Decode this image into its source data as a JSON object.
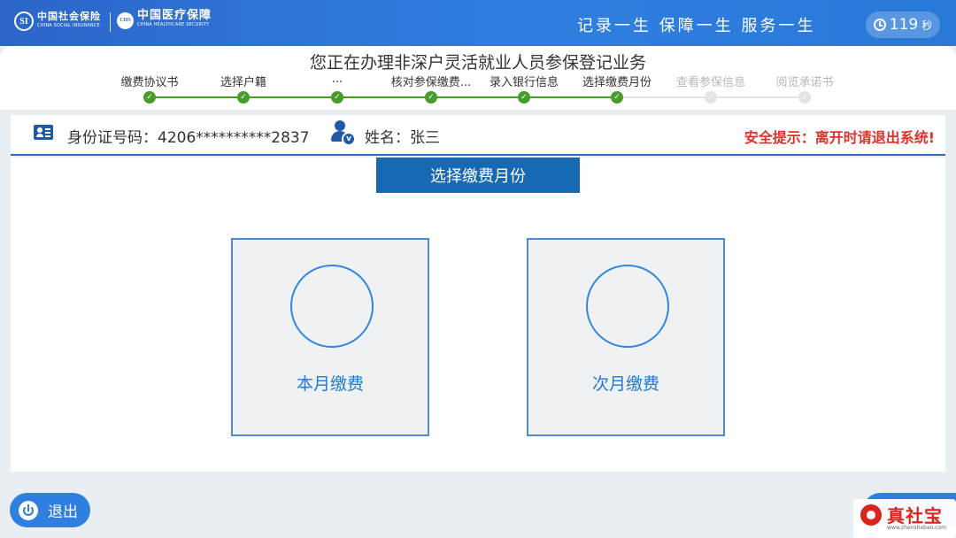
{
  "header": {
    "logo_social": {
      "cn": "中国社会保险",
      "en": "CHINA SOCIAL INSURANCE",
      "mark": "SI"
    },
    "logo_medical": {
      "cn": "中国医疗保障",
      "en": "CHINA HEALTHCARE SECURITY",
      "mark": "CHS"
    },
    "slogan": "记录一生 保障一生 服务一生",
    "timer_value": "119",
    "timer_unit": "秒"
  },
  "page_title": "您正在办理非深户灵活就业人员参保登记业务",
  "steps": [
    {
      "label": "缴费协议书",
      "status": "done"
    },
    {
      "label": "选择户籍",
      "status": "done"
    },
    {
      "label": "...",
      "status": "done"
    },
    {
      "label": "核对参保缴费...",
      "status": "done"
    },
    {
      "label": "录入银行信息",
      "status": "done"
    },
    {
      "label": "选择缴费月份",
      "status": "done"
    },
    {
      "label": "查看参保信息",
      "status": "pending"
    },
    {
      "label": "阅览承诺书",
      "status": "pending"
    }
  ],
  "info": {
    "id_text": "身份证号码：4206**********2837",
    "name_text": "姓名：张三",
    "safety_tip": "安全提示：离开时请退出系统!"
  },
  "section_title": "选择缴费月份",
  "options": [
    {
      "label": "本月缴费"
    },
    {
      "label": "次月缴费"
    }
  ],
  "footer": {
    "exit_label": "退出"
  },
  "watermark": {
    "name": "真社宝",
    "url": "www.zhenshebao.com"
  },
  "colors": {
    "header_blue": "#2f7fe0",
    "step_done": "#4a9b2d",
    "step_pending": "#e3e3e3",
    "section_blue": "#1769b3",
    "safety_red": "#e0322c",
    "card_label": "#1f78d1"
  }
}
